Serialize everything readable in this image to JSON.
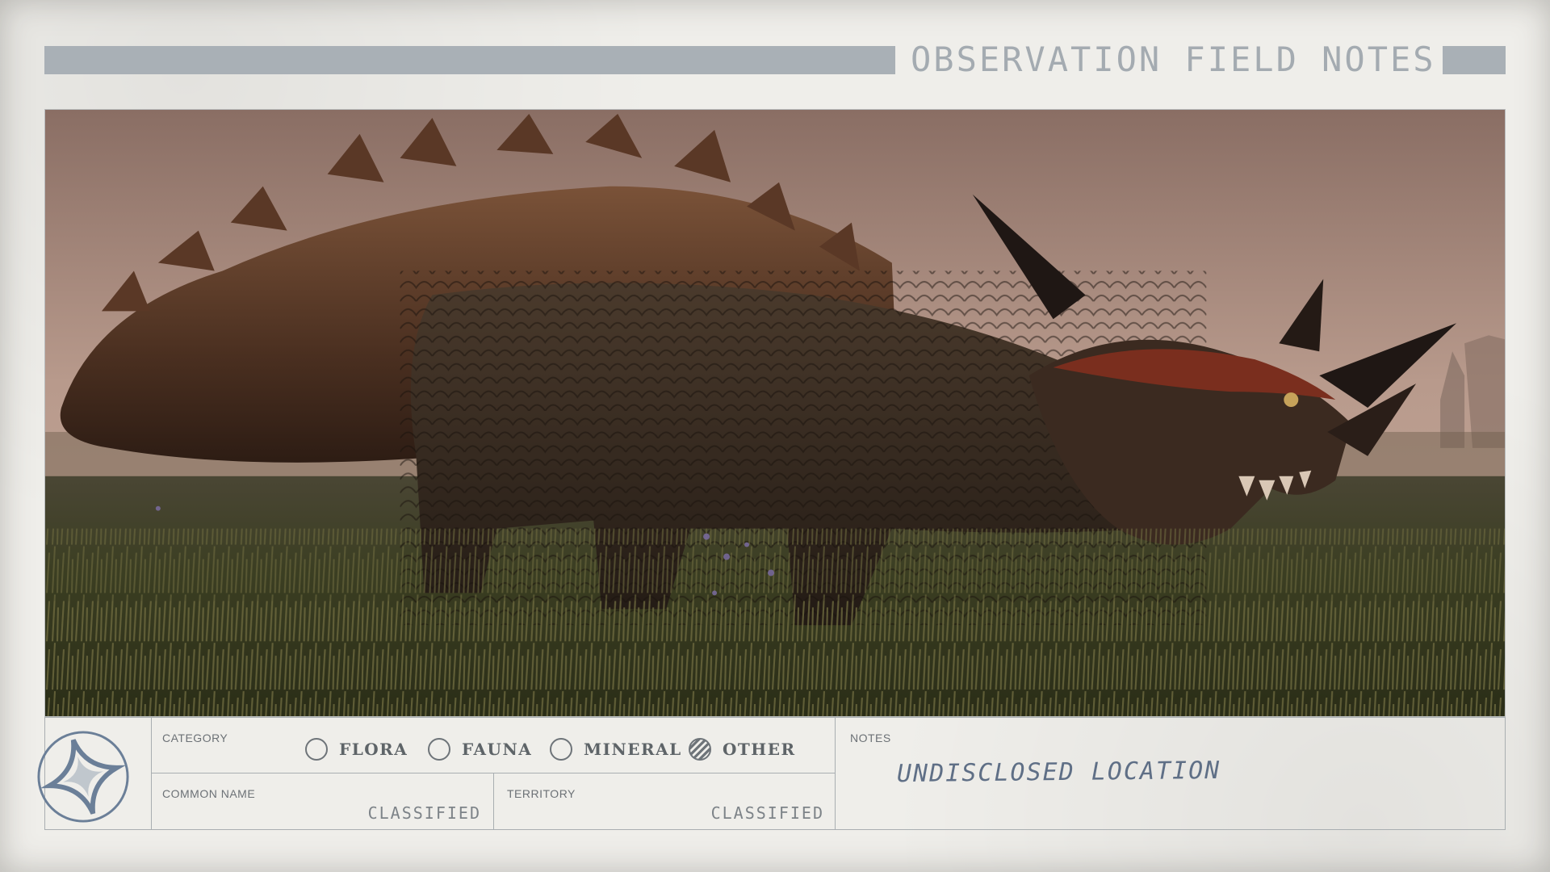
{
  "header": {
    "title": "OBSERVATION FIELD NOTES"
  },
  "panel": {
    "category_label": "CATEGORY",
    "options": [
      {
        "label": "FLORA",
        "selected": false
      },
      {
        "label": "FAUNA",
        "selected": false
      },
      {
        "label": "MINERAL",
        "selected": false
      },
      {
        "label": "OTHER",
        "selected": true
      }
    ],
    "common_name_label": "COMMON NAME",
    "common_name_value": "CLASSIFIED",
    "territory_label": "TERRITORY",
    "territory_value": "CLASSIFIED",
    "notes_label": "NOTES",
    "notes_value": "UNDISCLOSED LOCATION"
  },
  "colors": {
    "paper": "#efeeea",
    "header_bar": "#a9b0b6",
    "ink_blue": "#5f6f86",
    "emblem": "#6b7f98"
  },
  "icons": {
    "emblem": "star-compass-emblem-icon"
  }
}
